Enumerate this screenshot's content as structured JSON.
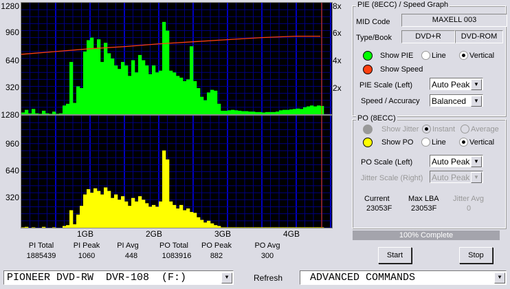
{
  "left_axis_top": [
    "1280",
    "960",
    "640",
    "320"
  ],
  "left_axis_bottom": [
    "1280",
    "960",
    "640",
    "320"
  ],
  "right_axis": [
    "8x",
    "6x",
    "4x",
    "2x"
  ],
  "x_axis": [
    "1GB",
    "2GB",
    "3GB",
    "4GB"
  ],
  "stats": [
    {
      "label": "PI Total",
      "value": "1885439"
    },
    {
      "label": "PI Peak",
      "value": "1060"
    },
    {
      "label": "PI Avg",
      "value": "448"
    },
    {
      "label": "PO Total",
      "value": "1083916"
    },
    {
      "label": "PO Peak",
      "value": "882"
    },
    {
      "label": "PO Avg",
      "value": "300"
    }
  ],
  "pie_panel": {
    "title": "PIE (8ECC) / Speed Graph",
    "mid_label": "MID Code",
    "mid_value": "MAXELL  003",
    "type_label": "Type/Book",
    "type_value": "DVD+R",
    "book_value": "DVD-ROM",
    "show_pie": "Show PIE",
    "line": "Line",
    "vertical": "Vertical",
    "show_speed": "Show Speed",
    "pie_scale_label": "PIE Scale (Left)",
    "pie_scale_value": "Auto Peak",
    "speed_label": "Speed / Accuracy",
    "speed_value": "Balanced"
  },
  "po_panel": {
    "title": "PO (8ECC)",
    "show_jitter": "Show Jitter",
    "instant": "Instant",
    "average": "Average",
    "show_po": "Show PO",
    "line": "Line",
    "vertical": "Vertical",
    "po_scale_label": "PO Scale (Left)",
    "po_scale_value": "Auto Peak",
    "jitter_scale_label": "Jitter Scale (Right)",
    "jitter_scale_value": "Auto Peak",
    "current_label": "Current",
    "current_value": "23053F",
    "maxlba_label": "Max LBA",
    "maxlba_value": "23053F",
    "jitter_avg_label": "Jitter Avg",
    "jitter_avg_value": "0"
  },
  "progress": {
    "text": "100% Complete",
    "percent": 100
  },
  "buttons": {
    "start": "Start",
    "stop": "Stop",
    "refresh": "Refresh"
  },
  "drive": "PIONEER DVD-RW  DVR-108  (F:)",
  "advanced": "ADVANCED COMMANDS",
  "colors": {
    "pie": "#00ff00",
    "po": "#ffff00",
    "speed": "#ff4010",
    "grid_major": "#0000ff",
    "grid_minor": "#000080"
  },
  "chart_data": [
    {
      "type": "bar",
      "title": "PIE (8ECC)",
      "xlabel": "GB",
      "x_step": 0.05,
      "ylim": [
        0,
        1280
      ],
      "xlim": [
        0,
        4.52
      ],
      "values": [
        20,
        50,
        10,
        60,
        10,
        5,
        40,
        10,
        5,
        30,
        5,
        10,
        100,
        120,
        600,
        130,
        320,
        300,
        720,
        850,
        880,
        760,
        860,
        600,
        820,
        700,
        640,
        560,
        520,
        600,
        560,
        440,
        620,
        480,
        680,
        620,
        560,
        460,
        560,
        480,
        500,
        1060,
        960,
        500,
        480,
        440,
        420,
        380,
        400,
        780,
        380,
        300,
        200,
        160,
        250,
        280,
        270,
        120,
        40,
        40,
        45,
        50,
        45,
        40,
        35,
        35,
        30,
        30,
        25,
        25,
        20,
        25,
        25,
        25,
        30,
        45,
        50,
        50,
        55,
        60,
        65,
        60,
        80,
        90,
        100,
        90,
        100,
        95
      ],
      "speed": {
        "ylim": [
          0,
          8
        ],
        "x": [
          0,
          0.5,
          1.0,
          1.5,
          2.0,
          2.5,
          3.0,
          3.5,
          4.0,
          4.35
        ],
        "y": [
          4.3,
          4.5,
          4.7,
          4.85,
          5.05,
          5.2,
          5.35,
          5.5,
          5.6,
          5.6
        ]
      }
    },
    {
      "type": "bar",
      "title": "PO (8ECC)",
      "xlabel": "GB",
      "x_step": 0.05,
      "ylim": [
        0,
        1280
      ],
      "xlim": [
        0,
        4.52
      ],
      "values": [
        5,
        10,
        0,
        5,
        0,
        0,
        10,
        0,
        0,
        5,
        0,
        0,
        20,
        30,
        200,
        40,
        150,
        250,
        380,
        440,
        400,
        450,
        420,
        380,
        460,
        420,
        340,
        380,
        320,
        360,
        300,
        250,
        340,
        300,
        360,
        320,
        280,
        240,
        260,
        240,
        300,
        882,
        780,
        300,
        260,
        220,
        260,
        200,
        220,
        180,
        170,
        120,
        90,
        60,
        80,
        50,
        30,
        20,
        5,
        5,
        5,
        5,
        5,
        5,
        5,
        5,
        5,
        5,
        5,
        5,
        5,
        5,
        5,
        5,
        5,
        5,
        5,
        5,
        5,
        5,
        5,
        5,
        5,
        5,
        5,
        5,
        5,
        5
      ]
    }
  ]
}
